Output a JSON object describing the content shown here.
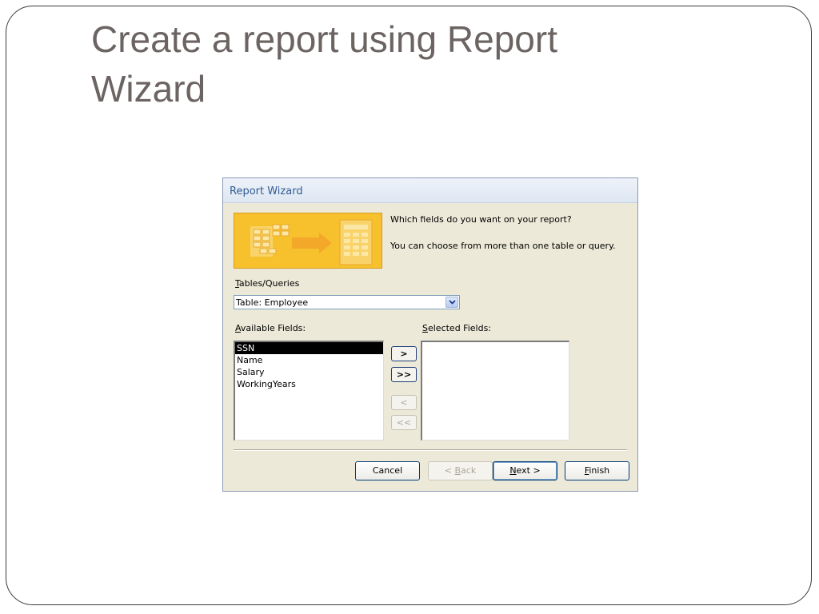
{
  "slide": {
    "title_line1": "Create a report using Report",
    "title_line2": "Wizard"
  },
  "dialog": {
    "title": "Report Wizard",
    "prompt_question": "Which fields do you want on your report?",
    "prompt_hint": "You can choose from more than one table or query.",
    "tables_label": {
      "mnemonic": "T",
      "rest": "ables/Queries"
    },
    "tables_value": "Table: Employee",
    "available_label": {
      "mnemonic": "A",
      "rest": "vailable Fields:"
    },
    "selected_label": {
      "mnemonic": "S",
      "rest": "elected Fields:"
    },
    "available_fields": [
      "SSN",
      "Name",
      "Salary",
      "WorkingYears"
    ],
    "selected_field": "SSN",
    "selected_fields": [],
    "move_buttons": {
      "add_one": ">",
      "add_all": ">>",
      "remove_one": "<",
      "remove_all": "<<"
    },
    "buttons": {
      "cancel": "Cancel",
      "back": {
        "prefix": "< ",
        "mnemonic": "B",
        "rest": "ack"
      },
      "next": {
        "mnemonic": "N",
        "rest": "ext >"
      },
      "finish": {
        "mnemonic": "F",
        "rest": "inish"
      }
    }
  },
  "colors": {
    "slide_title": "#6b6462",
    "dialog_title": "#2f5b93",
    "dialog_background": "#ece9d8",
    "banner_orange": "#f7c12e",
    "selection": "#000000"
  }
}
